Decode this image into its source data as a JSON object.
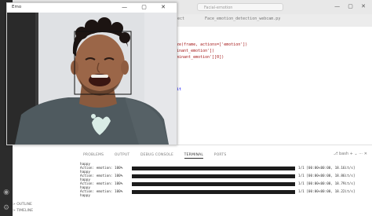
{
  "window": {
    "search_placeholder": "Facial-emotion",
    "controls": "— ▢ ✕"
  },
  "editor": {
    "tabs": [
      {
        "label": "ect"
      },
      {
        "label": "Face_emotion_detection_webcam.py"
      }
    ],
    "lines": [
      "yze(frame, actions=['emotion'])",
      "minant_emotion'])",
      "ominant_emotion'][0])",
      "",
      "",
      "oit"
    ]
  },
  "panel": {
    "tabs": [
      "PROBLEMS",
      "OUTPUT",
      "DEBUG CONSOLE",
      "TERMINAL",
      "PORTS"
    ],
    "active_tab": "TERMINAL",
    "actions": "⎇ bash + ⌄ ⋯ ✕",
    "progress_fraction": 1.0,
    "terminal": [
      {
        "label": "happy",
        "action": "Action: emotion: 100%",
        "after": "1/1 [00:00<00:00, 18.16it/s]"
      },
      {
        "label": "happy",
        "action": "Action: emotion: 100%",
        "after": "1/1 [00:00<00:00, 18.86it/s]"
      },
      {
        "label": "happy",
        "action": "Action: emotion: 100%",
        "after": "1/1 [00:00<00:00, 18.79it/s]"
      },
      {
        "label": "happy",
        "action": "Action: emotion: 100%",
        "after": "1/1 [00:00<00:00, 18.22it/s]"
      }
    ],
    "term_prompt": "happy"
  },
  "sidebar": {
    "outline": "> OUTLINE",
    "timeline": "> TIMELINE"
  },
  "camera": {
    "title": "Emo",
    "controls": "— ▢ ✕"
  }
}
